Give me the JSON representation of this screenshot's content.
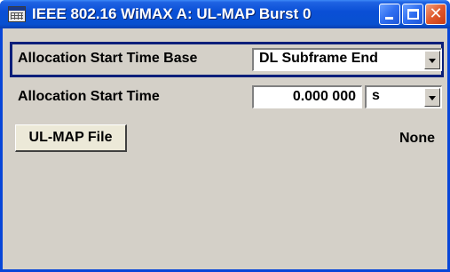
{
  "window": {
    "title": "IEEE 802.16 WiMAX A: UL-MAP Burst 0"
  },
  "form": {
    "allocation_start_time_base": {
      "label": "Allocation Start Time Base",
      "value": "DL Subframe End"
    },
    "allocation_start_time": {
      "label": "Allocation Start Time",
      "value": "0.000 000",
      "unit": "s"
    },
    "ul_map_file": {
      "button_label": "UL-MAP File",
      "value": "None"
    }
  },
  "icons": {
    "app": "window-app-icon",
    "minimize": "minimize-icon",
    "maximize": "maximize-icon",
    "close": "close-icon"
  },
  "colors": {
    "titlebar": "#0a4fd6",
    "panel": "#d4d0c8",
    "focus_frame": "#0a1f7a",
    "close_button": "#e0582c"
  }
}
